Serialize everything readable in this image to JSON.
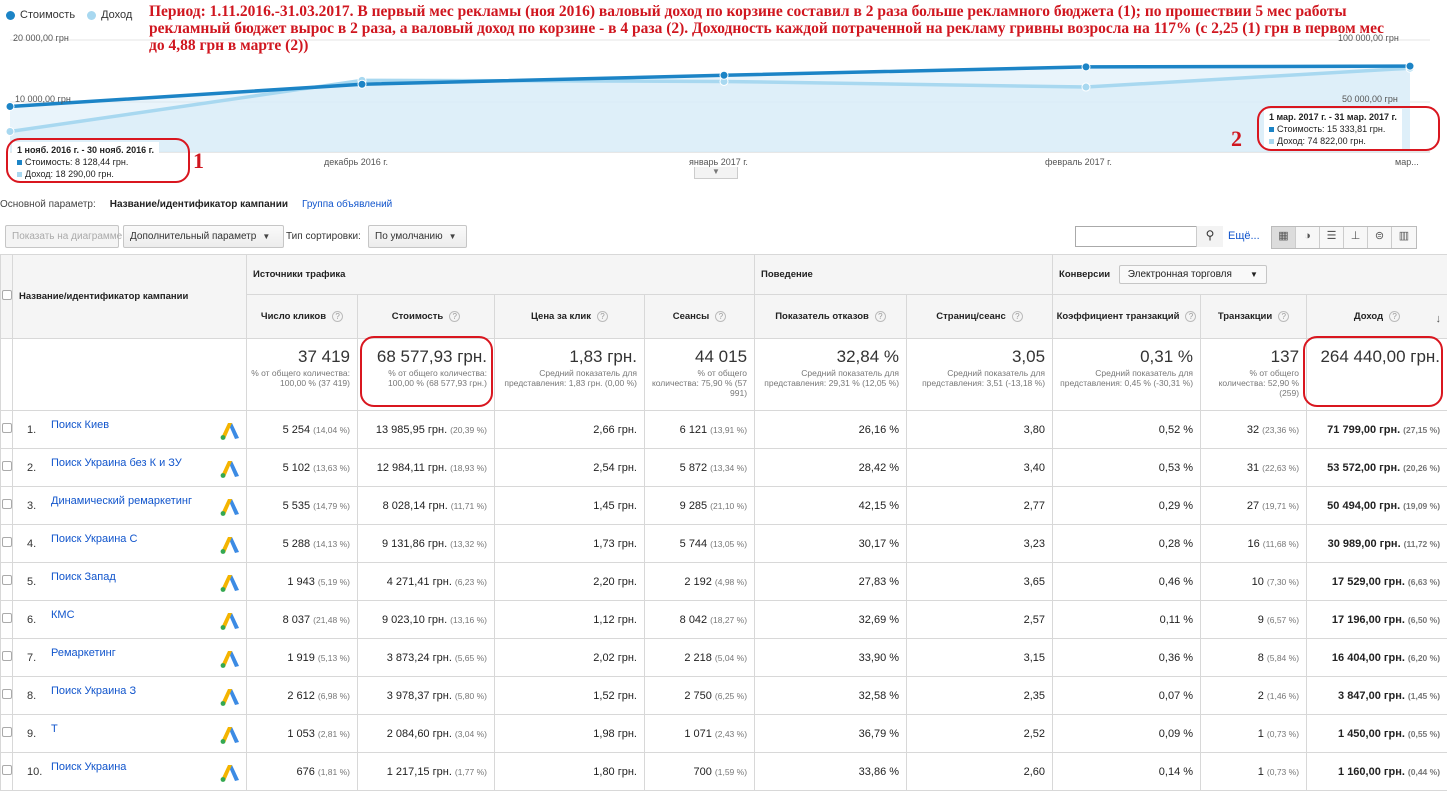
{
  "chart": {
    "legend": [
      {
        "label": "Стоимость",
        "color": "#1c84c6"
      },
      {
        "label": "Доход",
        "color": "#a8d8f0"
      }
    ],
    "y_left": [
      "20 000,00 грн",
      "10 000,00 грн"
    ],
    "y_right": [
      "100 000,00 грн",
      "50 000,00 грн"
    ],
    "months": [
      "декабрь 2016 г.",
      "январь 2017 г.",
      "февраль 2017 г.",
      "мар..."
    ],
    "series": {
      "cost": [
        8128.44,
        12100,
        13700,
        15200,
        15333.81
      ],
      "revenue": [
        18290,
        64000,
        63000,
        58000,
        74822
      ]
    }
  },
  "annotation": "Период: 1.11.2016.-31.03.2017. В первый мес рекламы (ноя 2016) валовый доход по корзине составил в 2 раза больше рекламного бюджета (1); по прошествии 5 мес работы рекламный бюджет вырос в 2 раза, а валовый доход по корзине - в 4 раза (2). Доходность каждой потраченной на рекламу гривны возросла на 117% (с 2,25 (1) грн в первом мес до 4,88 грн в марте (2))",
  "tooltip1": {
    "date": "1 нояб. 2016 г. - 30 нояб. 2016 г.",
    "cost": "Стоимость: 8 128,44 грн.",
    "rev": "Доход: 18 290,00 грн.",
    "num": "1"
  },
  "tooltip2": {
    "date": "1 мар. 2017 г. - 31 мар. 2017 г.",
    "cost": "Стоимость: 15 333,81 грн.",
    "rev": "Доход: 74 822,00 грн.",
    "num": "2"
  },
  "dimension": {
    "label": "Основной параметр:",
    "active": "Название/идентификатор кампании",
    "other": "Группа объявлений"
  },
  "toolbar": {
    "plot_btn": "Показать на диаграмме",
    "secondary": "Дополнительный параметр",
    "sort_label": "Тип сортировки:",
    "sort_value": "По умолчанию",
    "more": "Ещё..."
  },
  "table": {
    "groups": {
      "traffic": "Источники трафика",
      "behavior": "Поведение",
      "conversions": "Конверсии",
      "conv_select": "Электронная торговля"
    },
    "name_header": "Название/идентификатор кампании",
    "columns": [
      "Число кликов",
      "Стоимость",
      "Цена за клик",
      "Сеансы",
      "Показатель отказов",
      "Страниц/сеанс",
      "Коэффициент транзакций",
      "Транзакции",
      "Доход"
    ],
    "totals": [
      {
        "main": "37 419",
        "sub": "% от общего количества: 100,00 % (37 419)"
      },
      {
        "main": "68 577,93 грн.",
        "sub": "% от общего количества: 100,00 % (68 577,93 грн.)"
      },
      {
        "main": "1,83 грн.",
        "sub": "Средний показатель для представления: 1,83 грн. (0,00 %)"
      },
      {
        "main": "44 015",
        "sub": "% от общего количества: 75,90 % (57 991)"
      },
      {
        "main": "32,84 %",
        "sub": "Средний показатель для представления: 29,31 % (12,05 %)"
      },
      {
        "main": "3,05",
        "sub": "Средний показатель для представления: 3,51 (-13,18 %)"
      },
      {
        "main": "0,31 %",
        "sub": "Средний показатель для представления: 0,45 % (-30,31 %)"
      },
      {
        "main": "137",
        "sub": "% от общего количества: 52,90 % (259)"
      },
      {
        "main": "264 440,00 грн.",
        "sub": ""
      }
    ],
    "rows": [
      {
        "idx": "1.",
        "name": "Поиск Киев",
        "clicks": "5 254",
        "clicks_p": "(14,04 %)",
        "cost": "13 985,95 грн.",
        "cost_p": "(20,39 %)",
        "cpc": "2,66 грн.",
        "sessions": "6 121",
        "sessions_p": "(13,91 %)",
        "bounce": "26,16 %",
        "pages": "3,80",
        "conv": "0,52 %",
        "trans": "32",
        "trans_p": "(23,36 %)",
        "rev": "71 799,00 грн.",
        "rev_p": "(27,15 %)"
      },
      {
        "idx": "2.",
        "name": "Поиск Украина без К и ЗУ",
        "clicks": "5 102",
        "clicks_p": "(13,63 %)",
        "cost": "12 984,11 грн.",
        "cost_p": "(18,93 %)",
        "cpc": "2,54 грн.",
        "sessions": "5 872",
        "sessions_p": "(13,34 %)",
        "bounce": "28,42 %",
        "pages": "3,40",
        "conv": "0,53 %",
        "trans": "31",
        "trans_p": "(22,63 %)",
        "rev": "53 572,00 грн.",
        "rev_p": "(20,26 %)"
      },
      {
        "idx": "3.",
        "name": "Динамический ремаркетинг",
        "clicks": "5 535",
        "clicks_p": "(14,79 %)",
        "cost": "8 028,14 грн.",
        "cost_p": "(11,71 %)",
        "cpc": "1,45 грн.",
        "sessions": "9 285",
        "sessions_p": "(21,10 %)",
        "bounce": "42,15 %",
        "pages": "2,77",
        "conv": "0,29 %",
        "trans": "27",
        "trans_p": "(19,71 %)",
        "rev": "50 494,00 грн.",
        "rev_p": "(19,09 %)"
      },
      {
        "idx": "4.",
        "name": "Поиск Украина С",
        "clicks": "5 288",
        "clicks_p": "(14,13 %)",
        "cost": "9 131,86 грн.",
        "cost_p": "(13,32 %)",
        "cpc": "1,73 грн.",
        "sessions": "5 744",
        "sessions_p": "(13,05 %)",
        "bounce": "30,17 %",
        "pages": "3,23",
        "conv": "0,28 %",
        "trans": "16",
        "trans_p": "(11,68 %)",
        "rev": "30 989,00 грн.",
        "rev_p": "(11,72 %)"
      },
      {
        "idx": "5.",
        "name": "Поиск Запад",
        "clicks": "1 943",
        "clicks_p": "(5,19 %)",
        "cost": "4 271,41 грн.",
        "cost_p": "(6,23 %)",
        "cpc": "2,20 грн.",
        "sessions": "2 192",
        "sessions_p": "(4,98 %)",
        "bounce": "27,83 %",
        "pages": "3,65",
        "conv": "0,46 %",
        "trans": "10",
        "trans_p": "(7,30 %)",
        "rev": "17 529,00 грн.",
        "rev_p": "(6,63 %)"
      },
      {
        "idx": "6.",
        "name": "КМС",
        "clicks": "8 037",
        "clicks_p": "(21,48 %)",
        "cost": "9 023,10 грн.",
        "cost_p": "(13,16 %)",
        "cpc": "1,12 грн.",
        "sessions": "8 042",
        "sessions_p": "(18,27 %)",
        "bounce": "32,69 %",
        "pages": "2,57",
        "conv": "0,11 %",
        "trans": "9",
        "trans_p": "(6,57 %)",
        "rev": "17 196,00 грн.",
        "rev_p": "(6,50 %)"
      },
      {
        "idx": "7.",
        "name": "Ремаркетинг",
        "clicks": "1 919",
        "clicks_p": "(5,13 %)",
        "cost": "3 873,24 грн.",
        "cost_p": "(5,65 %)",
        "cpc": "2,02 грн.",
        "sessions": "2 218",
        "sessions_p": "(5,04 %)",
        "bounce": "33,90 %",
        "pages": "3,15",
        "conv": "0,36 %",
        "trans": "8",
        "trans_p": "(5,84 %)",
        "rev": "16 404,00 грн.",
        "rev_p": "(6,20 %)"
      },
      {
        "idx": "8.",
        "name": "Поиск Украина З",
        "clicks": "2 612",
        "clicks_p": "(6,98 %)",
        "cost": "3 978,37 грн.",
        "cost_p": "(5,80 %)",
        "cpc": "1,52 грн.",
        "sessions": "2 750",
        "sessions_p": "(6,25 %)",
        "bounce": "32,58 %",
        "pages": "2,35",
        "conv": "0,07 %",
        "trans": "2",
        "trans_p": "(1,46 %)",
        "rev": "3 847,00 грн.",
        "rev_p": "(1,45 %)"
      },
      {
        "idx": "9.",
        "name": "Т",
        "clicks": "1 053",
        "clicks_p": "(2,81 %)",
        "cost": "2 084,60 грн.",
        "cost_p": "(3,04 %)",
        "cpc": "1,98 грн.",
        "sessions": "1 071",
        "sessions_p": "(2,43 %)",
        "bounce": "36,79 %",
        "pages": "2,52",
        "conv": "0,09 %",
        "trans": "1",
        "trans_p": "(0,73 %)",
        "rev": "1 450,00 грн.",
        "rev_p": "(0,55 %)"
      },
      {
        "idx": "10.",
        "name": "Поиск Украина",
        "clicks": "676",
        "clicks_p": "(1,81 %)",
        "cost": "1 217,15 грн.",
        "cost_p": "(1,77 %)",
        "cpc": "1,80 грн.",
        "sessions": "700",
        "sessions_p": "(1,59 %)",
        "bounce": "33,86 %",
        "pages": "2,60",
        "conv": "0,14 %",
        "trans": "1",
        "trans_p": "(0,73 %)",
        "rev": "1 160,00 грн.",
        "rev_p": "(0,44 %)"
      }
    ]
  }
}
